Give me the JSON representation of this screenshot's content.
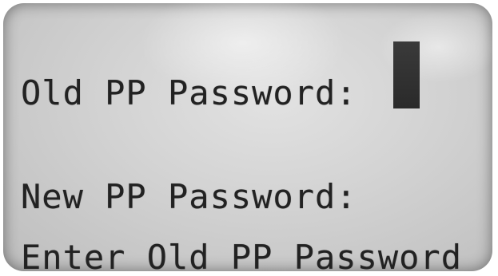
{
  "screen": {
    "old_password_label": "Old PP Password:",
    "new_password_label": "New PP Password:",
    "prompt": "Enter Old PP Password"
  },
  "colors": {
    "lcd_background": "#d2d2d2",
    "text": "#222222",
    "cursor": "#2a2a2a"
  }
}
